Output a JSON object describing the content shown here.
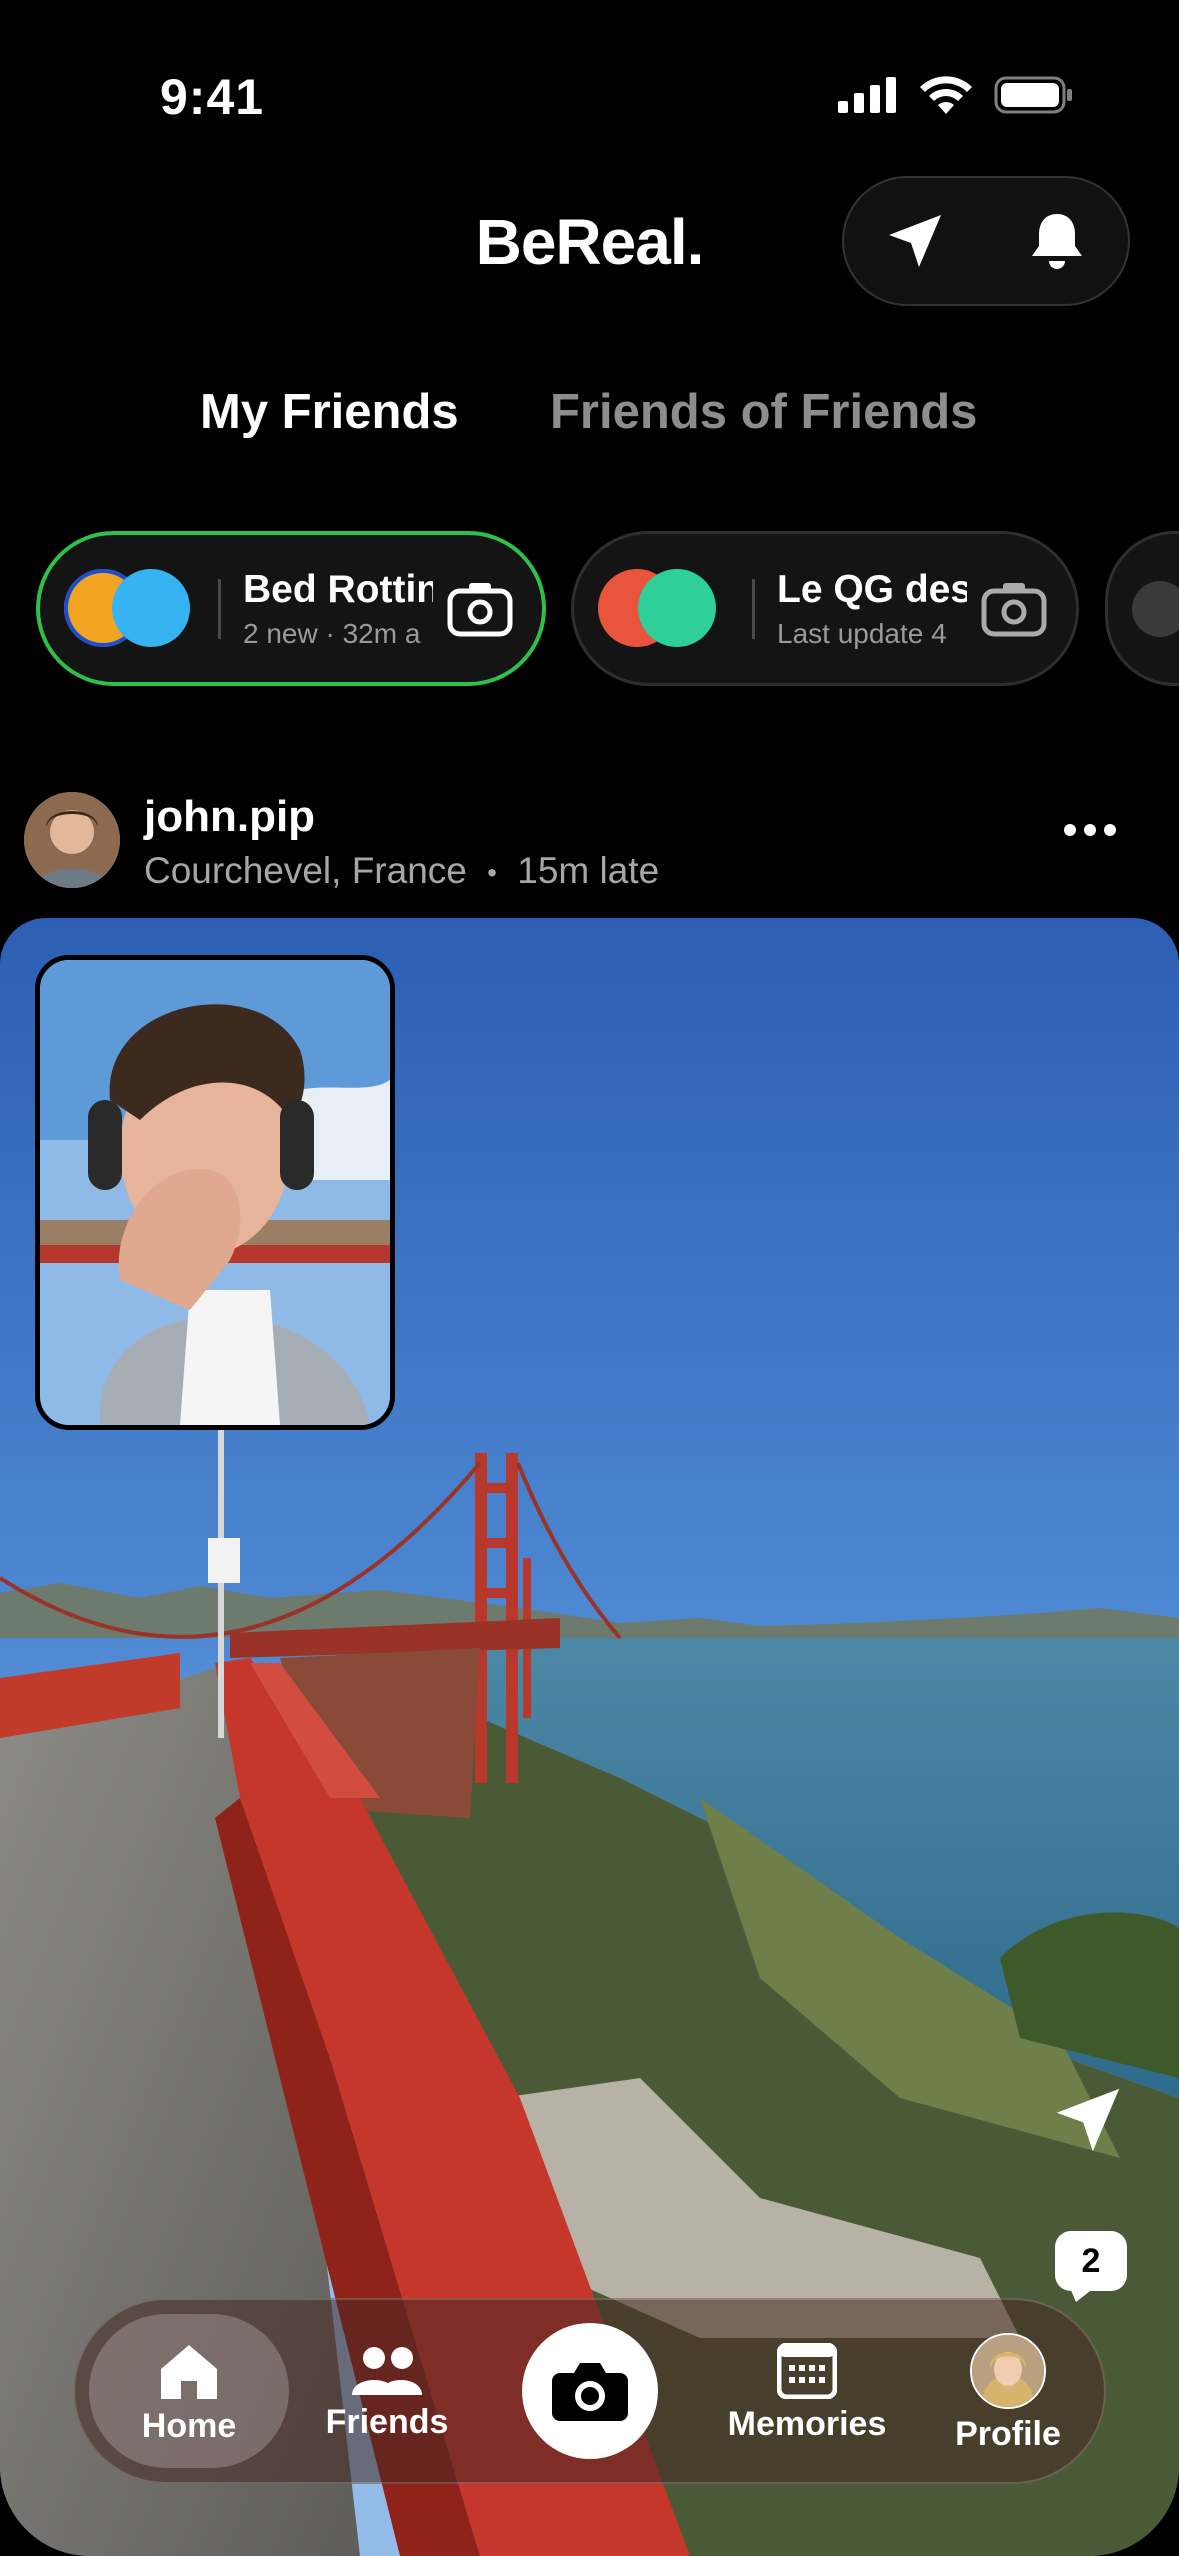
{
  "status_bar": {
    "time": "9:41",
    "icons": [
      "cellular-icon",
      "wifi-icon",
      "battery-icon"
    ]
  },
  "header": {
    "brand": "BeReal.",
    "actions": [
      "send-icon",
      "bell-icon"
    ]
  },
  "tabs": [
    {
      "label": "My Friends",
      "active": true
    },
    {
      "label": "Friends of Friends",
      "active": false
    }
  ],
  "groups": [
    {
      "name": "Bed Rottin",
      "subtitle": "2 new · 32m a",
      "active": true,
      "colors": [
        "#f2a322",
        "#36b3f0"
      ]
    },
    {
      "name": "Le QG des",
      "subtitle": "Last update 4",
      "active": false,
      "colors": [
        "#e8553c",
        "#2fcf9a"
      ]
    }
  ],
  "post": {
    "username": "john.pip",
    "location": "Courchevel, France",
    "separator": "•",
    "lateness": "15m late",
    "comment_count": "2"
  },
  "nav": {
    "home": "Home",
    "friends": "Friends",
    "memories": "Memories",
    "profile": "Profile"
  },
  "colors": {
    "active_ring": "#2fc04a",
    "inactive_text": "#8d8d8d"
  }
}
